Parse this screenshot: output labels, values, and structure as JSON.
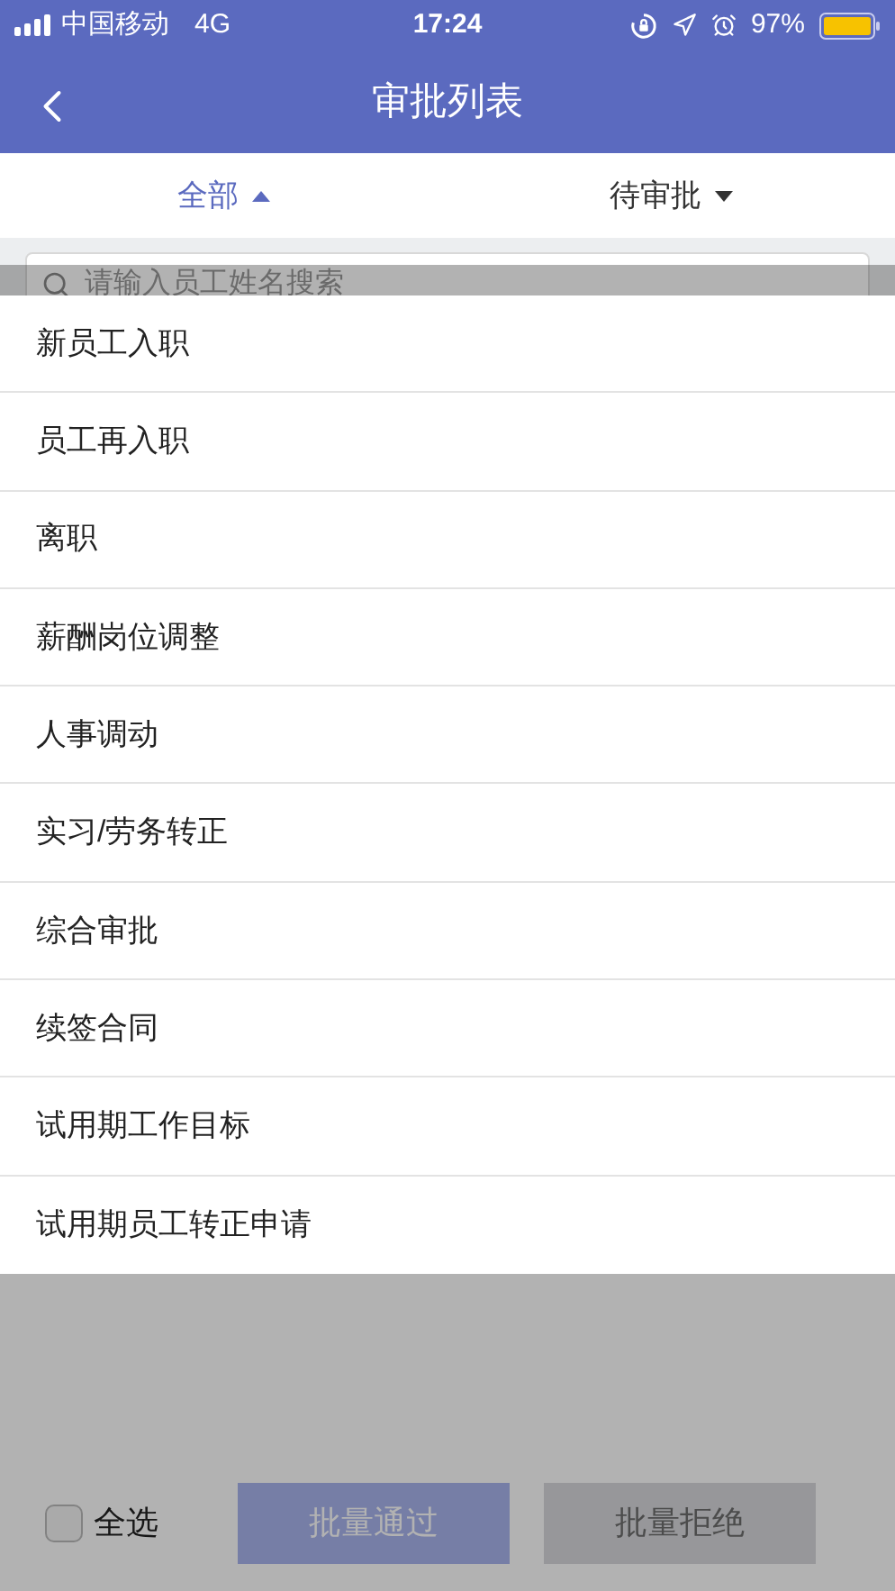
{
  "status_bar": {
    "carrier": "中国移动",
    "network": "4G",
    "time": "17:24",
    "battery": "97%"
  },
  "nav": {
    "title": "审批列表"
  },
  "filters": [
    {
      "label": "全部",
      "selected": true,
      "expanded": true
    },
    {
      "label": "待审批",
      "selected": false,
      "expanded": false
    }
  ],
  "search": {
    "placeholder": "请输入员工姓名搜索"
  },
  "dropdown": {
    "items": [
      {
        "label": "新员工入职"
      },
      {
        "label": "员工再入职"
      },
      {
        "label": "离职"
      },
      {
        "label": "薪酬岗位调整"
      },
      {
        "label": "人事调动"
      },
      {
        "label": "实习/劳务转正"
      },
      {
        "label": "综合审批"
      },
      {
        "label": "续签合同"
      },
      {
        "label": "试用期工作目标"
      },
      {
        "label": "试用期员工转正申请"
      }
    ]
  },
  "footer": {
    "select_all": {
      "label": "全选",
      "checked": false
    },
    "buttons": [
      {
        "label": "批量通过",
        "kind": "primary"
      },
      {
        "label": "批量拒绝",
        "kind": "secondary"
      }
    ]
  }
}
